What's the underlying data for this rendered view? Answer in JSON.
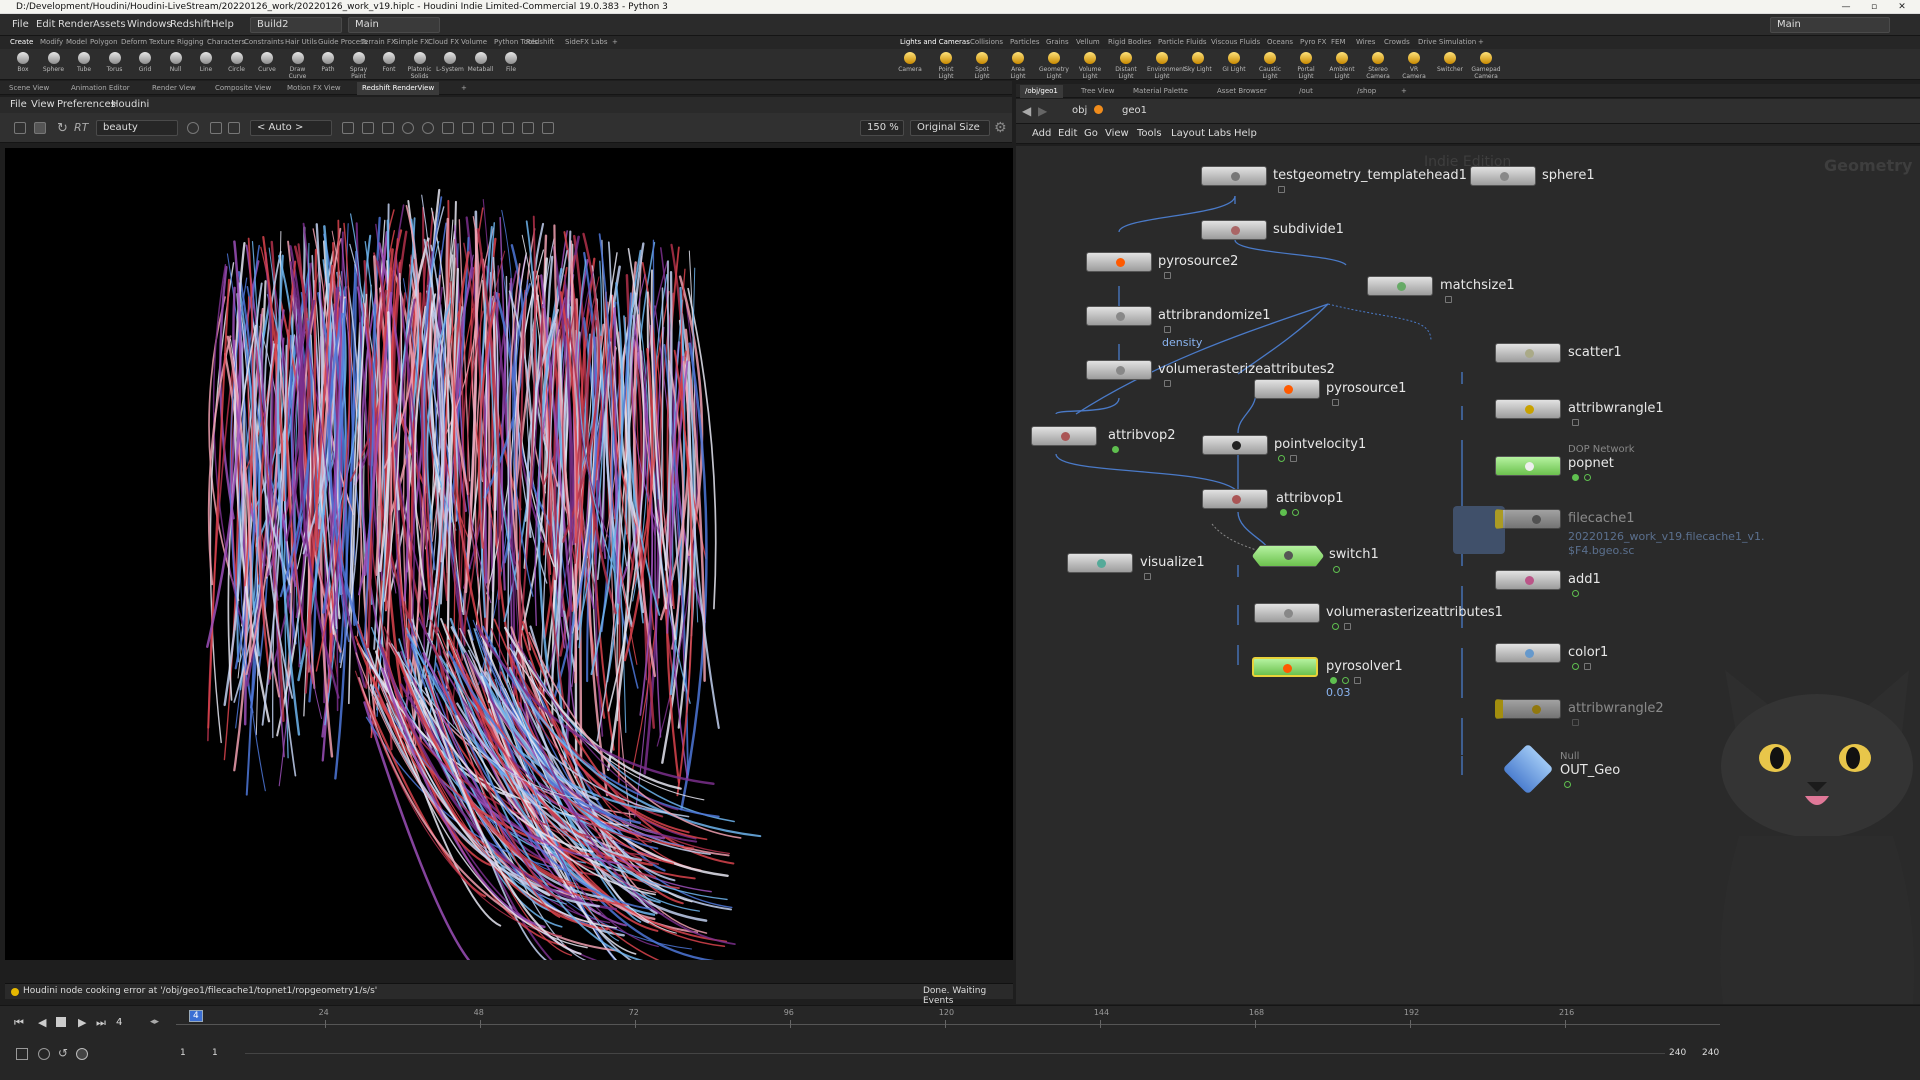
{
  "window": {
    "title": "D:/Development/Houdini/Houdini-LiveStream/20220126_work/20220126_work_v19.hiplc - Houdini Indie Limited-Commercial 19.0.383 - Python 3",
    "min_icon": "minimize-icon",
    "max_icon": "maximize-icon",
    "close_glyph": "✕"
  },
  "menubar": {
    "items": [
      "File",
      "Edit",
      "Render",
      "Assets",
      "Windows",
      "Redshift",
      "Help"
    ],
    "build": "Build2",
    "desktop": "Main",
    "right_desktop": "Main"
  },
  "shelf_tabs_left": [
    "Create",
    "Modify",
    "Model",
    "Polygon",
    "Deform",
    "Texture",
    "Rigging",
    "Characters",
    "Constraints",
    "Hair Utils",
    "Guide Process",
    "Terrain FX",
    "Simple FX",
    "Cloud FX",
    "Volume",
    "Python Tools",
    "Redshift",
    "SideFX Labs",
    "+"
  ],
  "shelf_tabs_right": [
    "Lights and Cameras",
    "Collisions",
    "Particles",
    "Grains",
    "Vellum",
    "Rigid Bodies",
    "Particle Fluids",
    "Viscous Fluids",
    "Oceans",
    "Pyro FX",
    "FEM",
    "Wires",
    "Crowds",
    "Drive Simulation",
    "+"
  ],
  "tools_left": [
    "Box",
    "Sphere",
    "Tube",
    "Torus",
    "Grid",
    "Null",
    "Line",
    "Circle",
    "Curve",
    "Draw Curve",
    "Path",
    "Spray Paint",
    "Font",
    "Platonic Solids",
    "L-System",
    "Metaball",
    "File"
  ],
  "tools_right": [
    "Camera",
    "Point Light",
    "Spot Light",
    "Area Light",
    "Geometry Light",
    "Volume Light",
    "Distant Light",
    "Environment Light",
    "Sky Light",
    "GI Light",
    "Caustic Light",
    "Portal Light",
    "Ambient Light",
    "Stereo Camera",
    "VR Camera",
    "Switcher",
    "Gamepad Camera"
  ],
  "left_pane_tabs": [
    "Scene View",
    "Animation Editor",
    "Render View",
    "Composite View",
    "Motion FX View",
    "Redshift RenderView",
    "+"
  ],
  "viewport": {
    "menu": [
      "File",
      "View",
      "Preferences",
      "Houdini"
    ],
    "rt_label": "RT",
    "aov": "beauty",
    "camera": "< Auto >",
    "zoom": "150 %",
    "size_mode": "Original Size",
    "status_message": "Houdini node cooking error at '/obj/geo1/filecache1/topnet1/ropgeometry1/s/s'",
    "status_right": "Done. Waiting Events"
  },
  "timeline": {
    "ticks": [
      "24",
      "48",
      "72",
      "96",
      "120",
      "144",
      "168",
      "192",
      "216"
    ],
    "current_frame": "4",
    "frame_field": "4",
    "start": "1",
    "start2": "1",
    "end": "240",
    "end2": "240"
  },
  "right_pane_tabs": [
    "/obj/geo1",
    "Tree View",
    "Material Palette",
    "Asset Browser",
    "/out",
    "/shop",
    "+"
  ],
  "net_path": [
    "obj",
    "geo1"
  ],
  "net_menu": [
    "Add",
    "Edit",
    "Go",
    "View",
    "Tools",
    "Layout",
    "Labs",
    "Help"
  ],
  "network": {
    "watermark": "Indie Edition",
    "context": "Geometry",
    "nodes": {
      "testgeometry": "testgeometry_templatehead1",
      "sphere": "sphere1",
      "subdivide": "subdivide1",
      "pyrosource2": "pyrosource2",
      "matchsize": "matchsize1",
      "attribrandomize": "attribrandomize1",
      "attribrandomize_sub": "density",
      "scatter": "scatter1",
      "volrast2": "volumerasterizeattributes2",
      "pyrosource1": "pyrosource1",
      "attribwrangle1": "attribwrangle1",
      "attribvop2": "attribvop2",
      "pointvelocity": "pointvelocity1",
      "popnet_type": "DOP Network",
      "popnet": "popnet",
      "attribvop1": "attribvop1",
      "filecache": "filecache1",
      "filecache_sub1": "20220126_work_v19.filecache1_v1.",
      "filecache_sub2": "$F4.bgeo.sc",
      "switch": "switch1",
      "visualize": "visualize1",
      "add": "add1",
      "volrast1": "volumerasterizeattributes1",
      "color": "color1",
      "pyrosolver": "pyrosolver1",
      "pyrosolver_sub": "0.03",
      "attribwrangle2": "attribwrangle2",
      "null_type": "Null",
      "out": "OUT_Geo"
    }
  }
}
